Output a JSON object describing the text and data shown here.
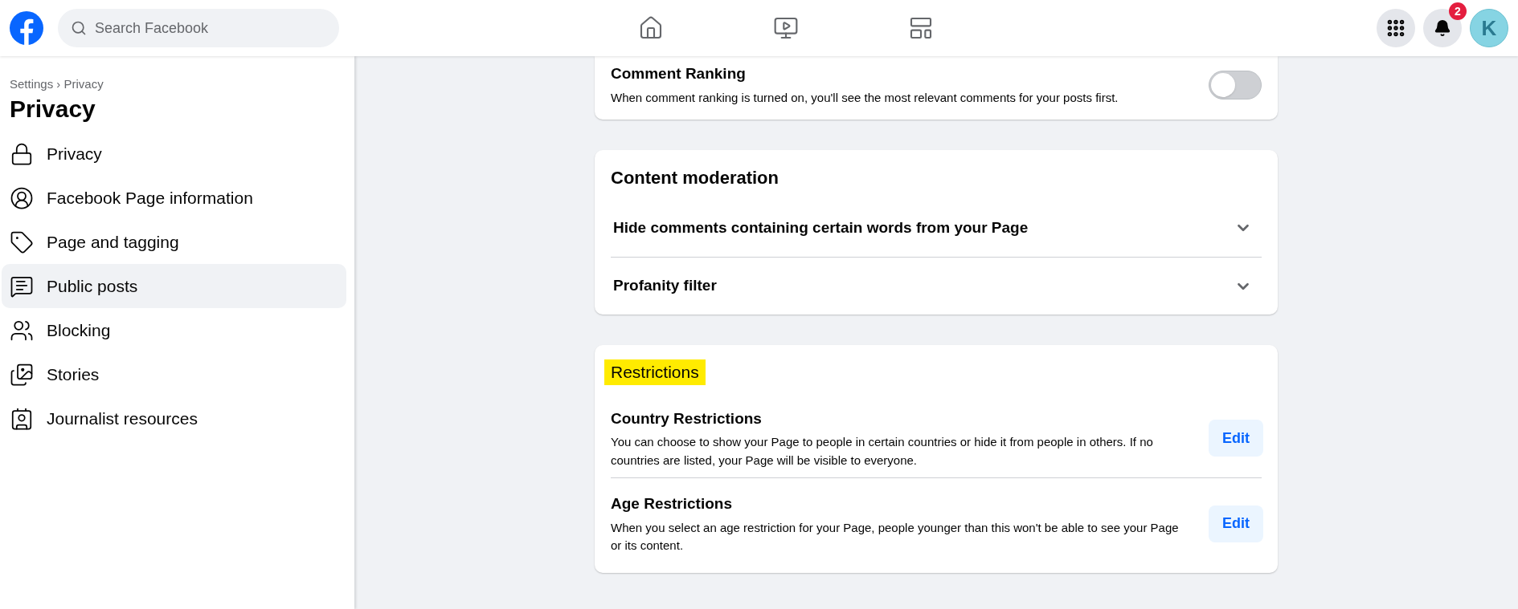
{
  "header": {
    "search": {
      "placeholder": "Search Facebook"
    },
    "nav": [
      {
        "kind": "home",
        "selected": false
      },
      {
        "kind": "video",
        "selected": false
      },
      {
        "kind": "gaming",
        "selected": false
      }
    ],
    "notifications_badge": "2",
    "avatar_initial": "K"
  },
  "sidebar": {
    "breadcrumb": "Settings › Privacy",
    "title": "Privacy",
    "items": [
      {
        "label": "Privacy",
        "kind": "lock",
        "selected": false
      },
      {
        "label": "Facebook Page information",
        "kind": "person",
        "selected": false
      },
      {
        "label": "Page and tagging",
        "kind": "tag",
        "selected": false
      },
      {
        "label": "Public posts",
        "kind": "posts",
        "selected": true
      },
      {
        "label": "Blocking",
        "kind": "blocking",
        "selected": false
      },
      {
        "label": "Stories",
        "kind": "stories",
        "selected": false
      },
      {
        "label": "Journalist resources",
        "kind": "journalist",
        "selected": false
      }
    ]
  },
  "comment_ranking": {
    "title": "Comment Ranking",
    "description": "When comment ranking is turned on, you'll see the most relevant comments for your posts first.",
    "on": false
  },
  "content_moderation": {
    "title": "Content moderation",
    "items": [
      {
        "label": "Hide comments containing certain words from your Page",
        "expanded": false
      },
      {
        "label": "Profanity filter",
        "expanded": false
      }
    ]
  },
  "restrictions": {
    "title": "Restrictions",
    "highlighted": true,
    "items": [
      {
        "title": "Country Restrictions",
        "description": "You can choose to show your Page to people in certain countries or hide it from people in others. If no countries are listed, your Page will be visible to everyone.",
        "button": "Edit"
      },
      {
        "title": "Age Restrictions",
        "description": "When you select an age restriction for your Page, people younger than this won't be able to see your Page or its content.",
        "button": "Edit"
      }
    ]
  }
}
